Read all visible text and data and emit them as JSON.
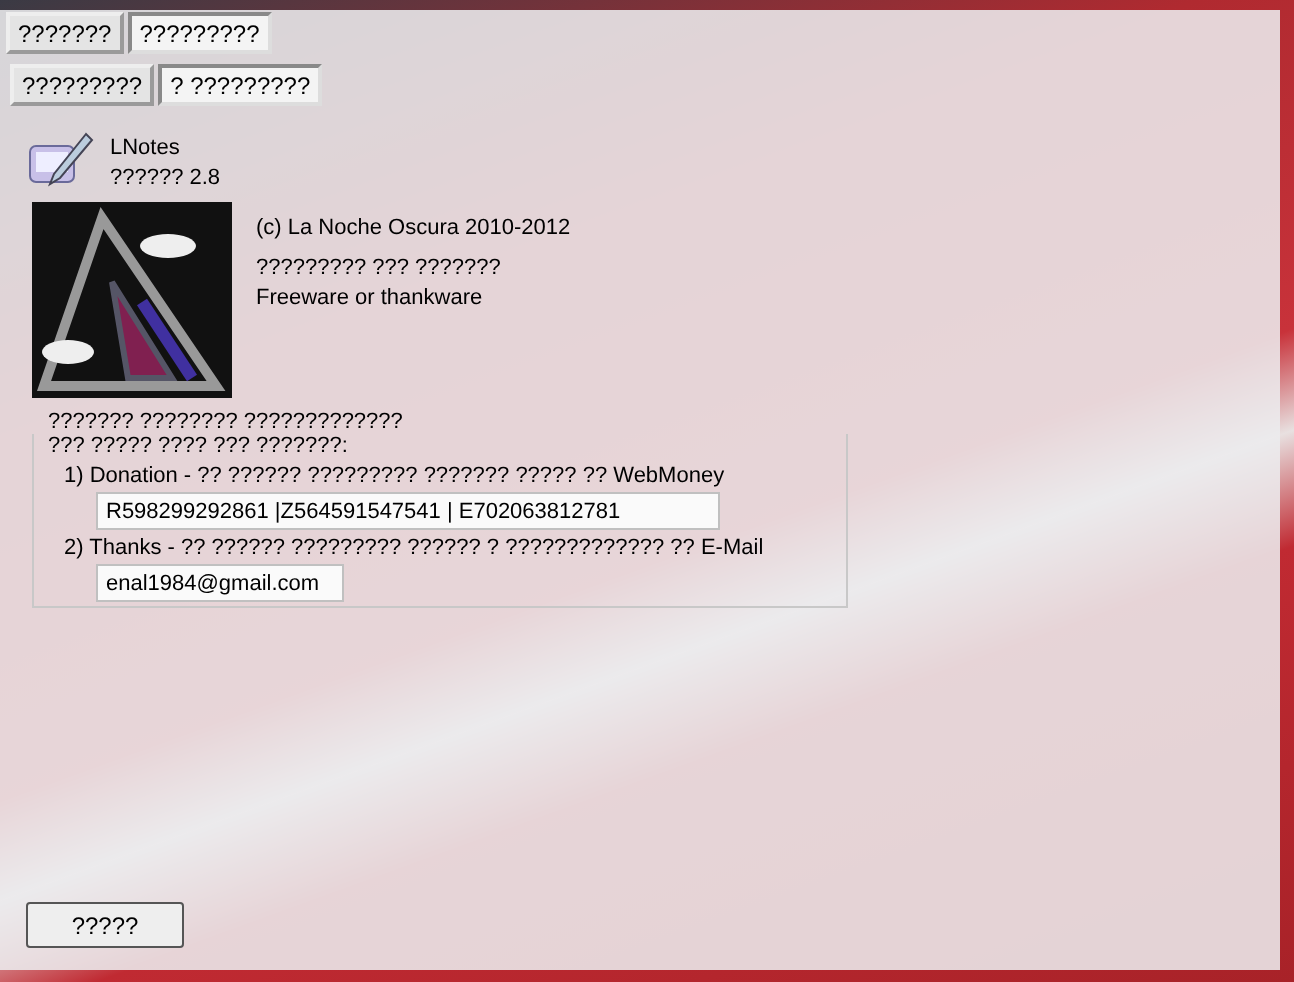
{
  "tabs_row_1": [
    {
      "label": "???????",
      "selected": false
    },
    {
      "label": "?????????",
      "selected": true
    }
  ],
  "tabs_row_2": [
    {
      "label": "?????????",
      "selected": false
    },
    {
      "label": "? ?????????",
      "selected": true
    }
  ],
  "app": {
    "name": "LNotes",
    "version": "?????? 2.8"
  },
  "about": {
    "copyright": "(c) La Noche Oscura 2010-2012",
    "line_2": "????????? ??? ???????",
    "license": "Freeware or thankware"
  },
  "support": {
    "title": "??????? ???????? ?????????????",
    "intro": "??? ????? ???? ??? ???????:",
    "items": [
      {
        "label": "1) Donation - ?? ?????? ????????? ??????? ????? ?? WebMoney",
        "value": "R598299292861 |Z564591547541 | E702063812781"
      },
      {
        "label": "2) Thanks - ?? ?????? ????????? ?????? ? ????????????? ?? E-Mail",
        "value": "enal1984@gmail.com"
      }
    ]
  },
  "buttons": [
    "?????"
  ]
}
